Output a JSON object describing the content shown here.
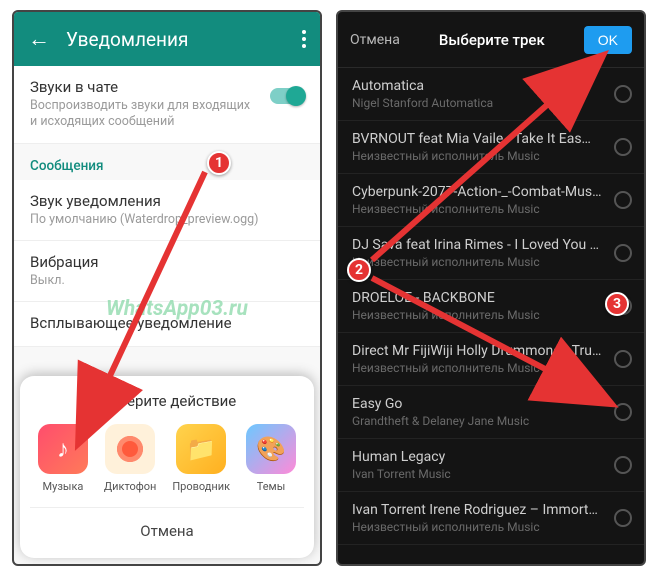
{
  "left": {
    "header": {
      "title": "Уведомления"
    },
    "sounds": {
      "title": "Звуки в чате",
      "subtitle": "Воспроизводить звуки для входящих и исходящих сообщений",
      "enabled": true
    },
    "section_messages": "Сообщения",
    "notif_sound": {
      "title": "Звук уведомления",
      "value": "По умолчанию (Waterdrop_preview.ogg)"
    },
    "vibration": {
      "title": "Вибрация",
      "value": "Выкл."
    },
    "popup": {
      "title": "Всплывающее уведомление"
    },
    "sheet": {
      "title": "Выберите действие",
      "apps": [
        {
          "label": "Музыка"
        },
        {
          "label": "Диктофон"
        },
        {
          "label": "Проводник"
        },
        {
          "label": "Темы"
        }
      ],
      "cancel": "Отмена"
    },
    "watermark": "WhatsApp03.ru"
  },
  "right": {
    "header": {
      "cancel": "Отмена",
      "title": "Выберите трек",
      "ok": "OK"
    },
    "tracks": [
      {
        "title": "Automatica",
        "sub": "Nigel Stanford Automatica"
      },
      {
        "title": "BVRNOUT feat Mia Vaile - Take It Eas…",
        "sub": "Неизвестный исполнитель Music"
      },
      {
        "title": "Cyberpunk-2077-Action-_-Combat-Musi…",
        "sub": "Неизвестный исполнитель Music"
      },
      {
        "title": "DJ Sava feat Irina Rimes - I Loved You f…",
        "sub": "Неизвестный исполнитель Music"
      },
      {
        "title": "DROELOE - BACKBONE",
        "sub": "Неизвестный исполнитель Music"
      },
      {
        "title": "Direct Mr FijiWiji Holly Drummond - Trus…",
        "sub": "Неизвестный исполнитель Music"
      },
      {
        "title": "Easy Go",
        "sub": "Grandtheft & Delaney Jane Music"
      },
      {
        "title": "Human Legacy",
        "sub": "Ivan Torrent Music"
      },
      {
        "title": "Ivan Torrent  Irene Rodriguez – Immortal…",
        "sub": "Неизвестный исполнитель Music"
      }
    ]
  },
  "badges": {
    "b1": "1",
    "b2": "2",
    "b3": "3"
  }
}
